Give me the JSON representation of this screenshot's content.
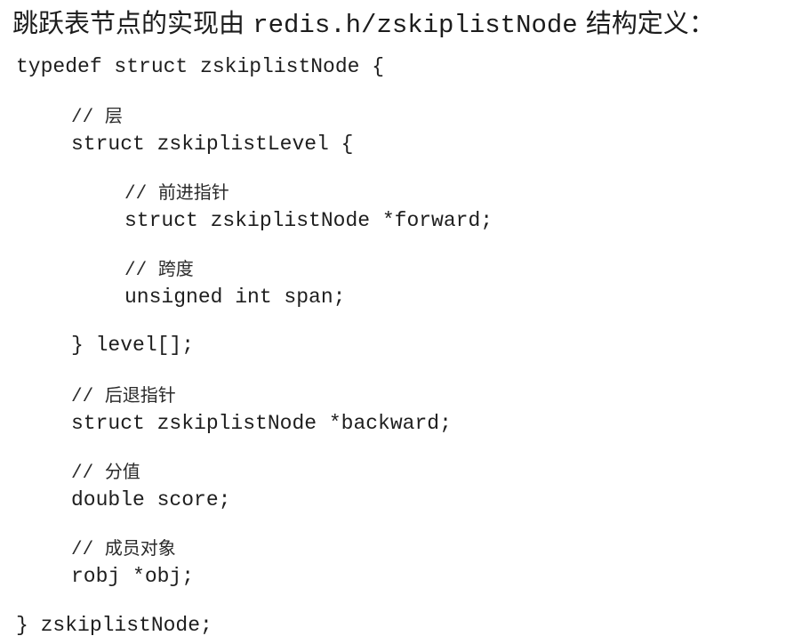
{
  "heading": {
    "prefix": "跳跃表节点的实现由 ",
    "code": "redis.h/zskiplistNode",
    "suffix": " 结构定义："
  },
  "code_lines": {
    "l1": "typedef struct zskiplistNode {",
    "c_level_slashes": "// ",
    "c_level_text": "层",
    "l2": "struct zskiplistLevel {",
    "c_forward_slashes": "// ",
    "c_forward_text": "前进指针",
    "l3": "struct zskiplistNode *forward;",
    "c_span_slashes": "// ",
    "c_span_text": "跨度",
    "l4": "unsigned int span;",
    "l5": "} level[];",
    "c_backward_slashes": "// ",
    "c_backward_text": "后退指针",
    "l6": "struct zskiplistNode *backward;",
    "c_score_slashes": "// ",
    "c_score_text": "分值",
    "l7": "double score;",
    "c_obj_slashes": "// ",
    "c_obj_text": "成员对象",
    "l8": "robj *obj;",
    "l9": "} zskiplistNode;"
  }
}
